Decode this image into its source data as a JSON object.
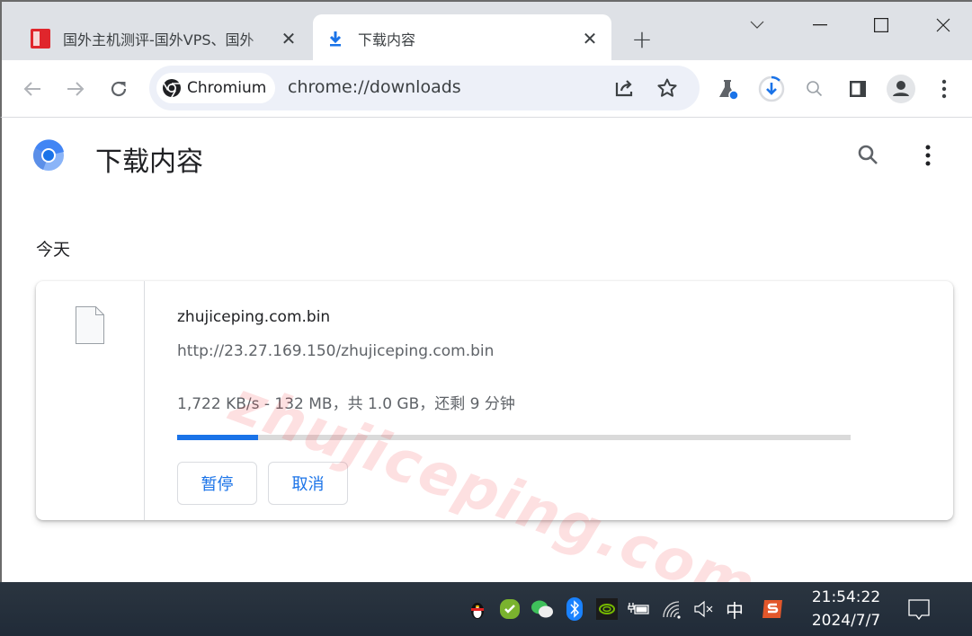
{
  "window": {
    "tabs": [
      {
        "title": "国外主机测评-国外VPS、国外",
        "favicon": "site-logo-icon",
        "active": false
      },
      {
        "title": "下载内容",
        "favicon": "download-icon",
        "active": true
      }
    ],
    "controls": [
      "tab-search-dropdown",
      "minimize",
      "maximize",
      "close"
    ]
  },
  "toolbar": {
    "chip_label": "Chromium",
    "url": "chrome://downloads",
    "icons": [
      "back-icon",
      "forward-icon",
      "reload-icon",
      "share-icon",
      "bookmark-star-icon",
      "labs-flask-icon",
      "download-progress-icon",
      "zoom-icon",
      "side-panel-icon",
      "profile-icon",
      "menu-icon"
    ]
  },
  "page": {
    "title": "下载内容",
    "section_label": "今天",
    "download": {
      "file_name": "zhujiceping.com.bin",
      "url": "http://23.27.169.150/zhujiceping.com.bin",
      "status": "1,722 KB/s - 132 MB，共 1.0 GB，还剩 9 分钟",
      "progress_percent": 12,
      "pause_label": "暂停",
      "cancel_label": "取消"
    },
    "watermark": "zhujiceping.com"
  },
  "taskbar": {
    "tray_icons": [
      "qq-icon",
      "security-check-icon",
      "wechat-icon",
      "bluetooth-icon",
      "nvidia-icon",
      "battery-charging-icon",
      "wifi-icon",
      "volume-muted-icon",
      "ime-chinese-icon",
      "sogou-input-icon"
    ],
    "ime_label": "中",
    "time": "21:54:22",
    "date": "2024/7/7"
  },
  "colors": {
    "accent": "#1a73e8",
    "tabstrip": "#dee1e6",
    "omnibox": "#edf0f8",
    "taskbar": "#232e3b"
  }
}
